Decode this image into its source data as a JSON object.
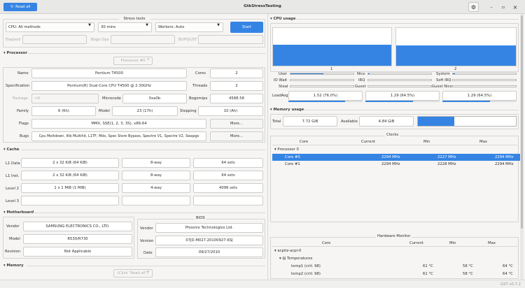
{
  "titlebar": {
    "read_all": "Read all",
    "title": "GtkStressTesting",
    "minimize": "–",
    "maximize": "▫",
    "close": "×"
  },
  "stress": {
    "title": "Stress tests",
    "method": "CPU: All methods",
    "duration": "30 mins",
    "workers": "Workers: Auto",
    "start": "Start",
    "elapsed": "Elapsed",
    "bogo_ops": "Bogo Ops",
    "bogops": "BOPS/UST"
  },
  "processor": {
    "section": "Processor",
    "selector": "Processor #0",
    "name_label": "Name",
    "name": "Pentium T4500",
    "cores_label": "Cores",
    "cores": "2",
    "spec_label": "Specification",
    "spec": "Pentium(R) Dual-Core CPU      T4500  @ 2.30GHz",
    "threads_label": "Threads",
    "threads": "2",
    "package_label": "Package",
    "package": "<0",
    "microcode_label": "Microcode",
    "microcode": "0xa0b",
    "bogomips_label": "Bogomips",
    "bogomips": "4588.58",
    "family_label": "Family",
    "family": "6 (6h)",
    "model_label": "Model",
    "model": "23 (17h)",
    "stepping_label": "Stepping",
    "stepping": "10 (Ah)",
    "flags_label": "Flags",
    "flags": "MMX, SSE(1, 2, 3, 3S), x86-64",
    "bugs_label": "Bugs",
    "bugs": "Cpu Meltdown, Itlb Multihit, L1TF, Mds, Spec Store Bypass, Spectre V1, Spectre V2, Swapgs",
    "more": "More..."
  },
  "cache": {
    "section": "Cache",
    "rows": [
      {
        "label": "L1 Data",
        "size": "2 x 32 KiB (64 KiB)",
        "ways": "8-way",
        "sets": "64 sets"
      },
      {
        "label": "L1 Inst.",
        "size": "2 x 32 KiB (64 KiB)",
        "ways": "8-way",
        "sets": "64 sets"
      },
      {
        "label": "Level 2",
        "size": "1 x 1 MiB (1 MiB)",
        "ways": "4-way",
        "sets": "4096 sets"
      },
      {
        "label": "Level 3",
        "size": "",
        "ways": "",
        "sets": ""
      }
    ]
  },
  "motherboard": {
    "section": "Motherboard",
    "vendor_label": "Vendor",
    "vendor": "SAMSUNG ELECTRONICS CO., LTD.",
    "model_label": "Model",
    "model": "R530/R730",
    "revision_label": "Revision",
    "revision": "Not Applicable"
  },
  "bios": {
    "title": "BIOS",
    "vendor_label": "Vendor",
    "vendor": "Phoenix Technologies Ltd.",
    "version_label": "Version",
    "version": "07JD.M027.20100927.KSJ",
    "date_label": "Date",
    "date": "09/27/2010"
  },
  "memory_left": {
    "section": "Memory",
    "selector": "(Click \"Read all\")"
  },
  "cpu_usage": {
    "section": "CPU usage",
    "graphs": [
      {
        "label": "1",
        "level": 0.55
      },
      {
        "label": "2",
        "level": 0.53
      }
    ],
    "user": "User",
    "nice": "Nice",
    "system": "System",
    "iowait": "IO Wait",
    "irq": "IRQ",
    "softirq": "Soft IRQ",
    "steal": "Steal",
    "guest": "Guest",
    "guestnice": "Guest Nice",
    "user_level": 0.52,
    "nice_level": 0.02,
    "system_level": 0.03,
    "loadavg_label": "LoadAvg",
    "loadavg": [
      "1.52 (76.0%)",
      "1.29 (64.5%)",
      "1.29 (64.5%)"
    ],
    "loadavg_levels": [
      0.76,
      0.645,
      0.645
    ]
  },
  "memory_usage": {
    "section": "Memory usage",
    "total_label": "Total",
    "total": "7.72 GiB",
    "available_label": "Available",
    "available": "4.84 GiB",
    "used_level": 0.37
  },
  "clocks": {
    "title": "Clocks",
    "headers": [
      "Core",
      "Current",
      "Min",
      "Max"
    ],
    "group": "Processor 0",
    "rows": [
      {
        "core": "Core #0",
        "current": "2294 MHz",
        "min": "2227 MHz",
        "max": "2294 MHz"
      },
      {
        "core": "Core #1",
        "current": "2294 MHz",
        "min": "2228 MHz",
        "max": "2294 MHz"
      }
    ]
  },
  "hwmon": {
    "title": "Hardware Monitor",
    "headers": [
      "Core",
      "Current",
      "Min",
      "Max"
    ],
    "chip": "acpitz-acpi-0",
    "group": "Temperatures",
    "rows": [
      {
        "sensor": "temp1 (crit: 98)",
        "current": "61 °C",
        "min": "58 °C",
        "max": "64 °C"
      },
      {
        "sensor": "temp2 (crit: 98)",
        "current": "61 °C",
        "min": "58 °C",
        "max": "64 °C"
      }
    ]
  },
  "footer": {
    "version": "GST v0.7.2"
  }
}
